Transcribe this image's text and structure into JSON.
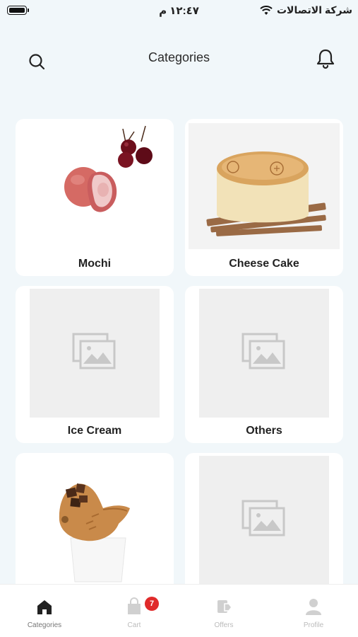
{
  "status_bar": {
    "time": "١٢:٤٧ م",
    "carrier": "شركة الاتصالات",
    "icons": [
      "battery-icon",
      "wifi-icon"
    ]
  },
  "header": {
    "title": "Categories",
    "search_icon": "search-icon",
    "bell_icon": "bell-icon"
  },
  "categories": [
    {
      "label": "Mochi",
      "image": "mochi-photo"
    },
    {
      "label": "Cheese Cake",
      "image": "cheesecake-photo"
    },
    {
      "label": "Ice Cream",
      "image": "placeholder-image-icon"
    },
    {
      "label": "Others",
      "image": "placeholder-image-icon"
    },
    {
      "label": "",
      "image": "taiyaki-icecream-photo"
    },
    {
      "label": "",
      "image": "placeholder-image-icon"
    }
  ],
  "bottom_nav": {
    "items": [
      {
        "label": "Categories",
        "icon": "home-icon",
        "active": true
      },
      {
        "label": "Cart",
        "icon": "cart-icon",
        "badge": "7"
      },
      {
        "label": "Offers",
        "icon": "offers-icon"
      },
      {
        "label": "Profile",
        "icon": "profile-icon"
      }
    ]
  },
  "colors": {
    "background": "#f1f7fa",
    "card": "#ffffff",
    "badge": "#e02a2a",
    "nav_active": "#222222",
    "nav_inactive": "#bbbbbb"
  }
}
